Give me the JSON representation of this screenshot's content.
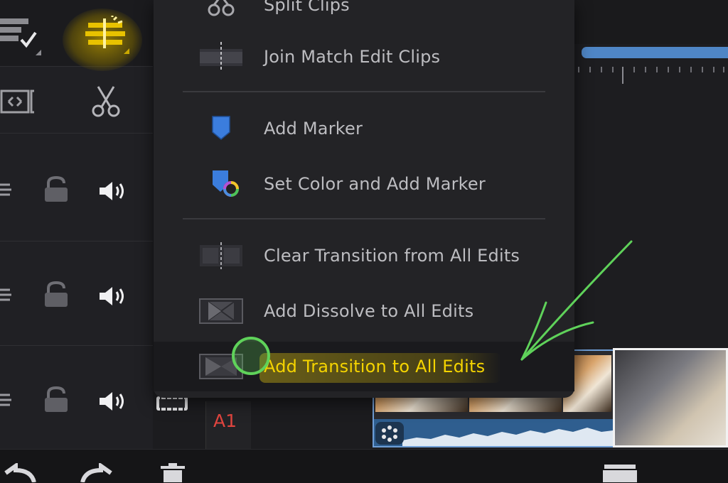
{
  "menu": {
    "items": [
      {
        "label": "Split Clips",
        "icon": "split-clips-icon"
      },
      {
        "label": "Join Match Edit Clips",
        "icon": "join-clips-icon"
      },
      {
        "label": "Add Marker",
        "icon": "marker-icon"
      },
      {
        "label": "Set Color and Add Marker",
        "icon": "color-marker-icon"
      },
      {
        "label": "Clear Transition from All Edits",
        "icon": "clear-transition-icon"
      },
      {
        "label": "Add Dissolve to All Edits",
        "icon": "dissolve-icon"
      },
      {
        "label": "Add Transition to All Edits",
        "icon": "transition-icon"
      }
    ],
    "active_index": 6
  },
  "tracks": {
    "audio_label": "A1"
  },
  "colors": {
    "accent_yellow": "#f5d400",
    "marker_blue": "#3b7ddd",
    "annotation_green": "#5fd25a",
    "a1_red": "#e0453f",
    "timeline_blue": "#4f86c6"
  }
}
